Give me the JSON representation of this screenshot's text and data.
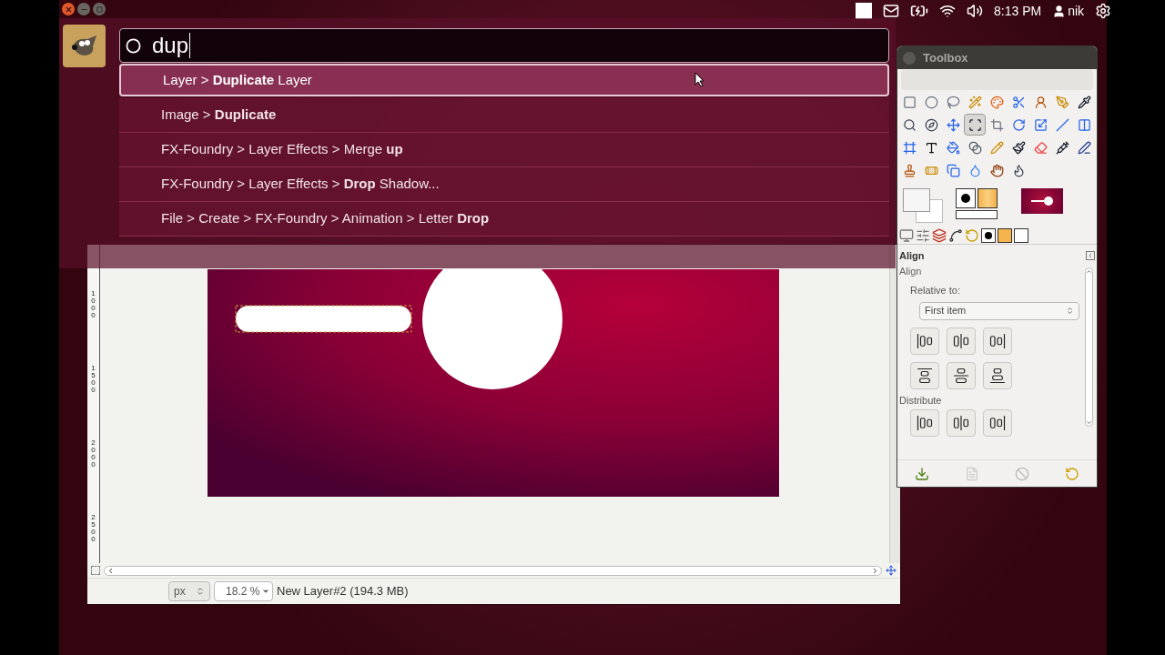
{
  "top_panel": {
    "clock": "8:13 PM",
    "user": "nik"
  },
  "hud": {
    "query": "dup",
    "results": [
      {
        "text": "Layer > **Duplicate** Layer",
        "selected": true
      },
      {
        "text": "Image > **Duplicate**",
        "selected": false
      },
      {
        "text": "FX-Foundry > Layer Effects > Merge **up**",
        "selected": false
      },
      {
        "text": "FX-Foundry > Layer Effects > **Drop** Shadow...",
        "selected": false
      },
      {
        "text": "File > Create > FX-Foundry > Animation > Letter **Drop**",
        "selected": false
      }
    ]
  },
  "image_window": {
    "ruler_labels": [
      "1000",
      "1500",
      "2000",
      "2500"
    ],
    "unit": "px",
    "zoom": "18.2 %",
    "status": "New Layer#2 (194.3 MB)"
  },
  "toolbox": {
    "title": "Toolbox",
    "tools": [
      {
        "selected": false
      },
      {
        "selected": false
      },
      {
        "selected": false
      },
      {
        "selected": false
      },
      {
        "selected": false
      },
      {
        "selected": false
      },
      {
        "selected": false
      },
      {
        "selected": false
      },
      {
        "selected": false
      },
      {
        "selected": false
      },
      {
        "selected": false
      },
      {
        "selected": false
      },
      {
        "selected": true
      },
      {
        "selected": false
      },
      {
        "selected": false
      },
      {
        "selected": false
      },
      {
        "selected": false
      },
      {
        "selected": false
      },
      {
        "selected": false
      },
      {
        "selected": false
      },
      {
        "selected": false
      },
      {
        "selected": false
      },
      {
        "selected": false
      },
      {
        "selected": false
      },
      {
        "selected": false
      },
      {
        "selected": false
      },
      {
        "selected": false
      },
      {
        "selected": false
      },
      {
        "selected": false
      },
      {
        "selected": false
      },
      {
        "selected": false
      },
      {
        "selected": false
      },
      {
        "selected": false
      }
    ],
    "align": {
      "tab_label": "Align",
      "heading": "Align",
      "relative_label": "Relative to:",
      "relative_value": "First item",
      "distribute_label": "Distribute"
    }
  }
}
